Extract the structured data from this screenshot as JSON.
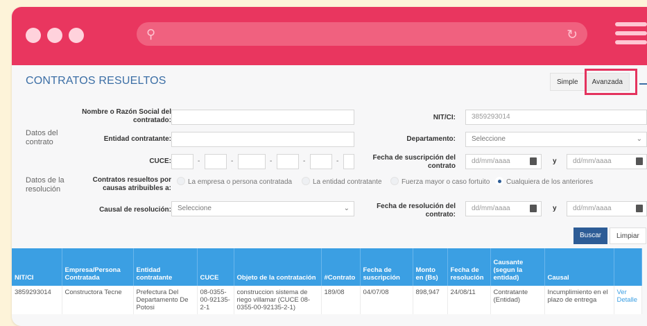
{
  "browser": {
    "search_icon": "search-icon",
    "reload_icon": "reload-icon",
    "menu_icon": "hamburger-menu-icon",
    "accent_color": "#e9365f"
  },
  "page": {
    "title": "CONTRATOS RESUELTOS",
    "tabs": [
      "Simple",
      "Avanzada"
    ],
    "active_tab": "Avanzada"
  },
  "form": {
    "section_contract": "Datos del contrato",
    "section_resolution": "Datos de la resolución",
    "razon_social_label": "Nombre o Razón Social del contratado:",
    "razon_social_value": "",
    "nit_label": "NIT/CI:",
    "nit_value": "3859293014",
    "entidad_label": "Entidad contratante:",
    "entidad_value": "",
    "departamento_label": "Departamento:",
    "departamento_value": "Seleccione",
    "cuce_label": "CUCE:",
    "cuce_separator": "-",
    "fecha_suscripcion_label": "Fecha de suscripción del contrato",
    "date_placeholder": "dd/mm/aaaa",
    "y_label": "y",
    "atribuibles_label": "Contratos resueltos por causas atribuibles a:",
    "radio_options": [
      "La empresa o persona contratada",
      "La entidad contratante",
      "Fuerza mayor o caso fortuito",
      "Cualquiera de los anteriores"
    ],
    "radio_selected": "Cualquiera de los anteriores",
    "causal_label": "Causal de resolución:",
    "causal_value": "Seleccione",
    "fecha_resolucion_label": "Fecha de resolución del contrato:",
    "buscar_label": "Buscar",
    "limpiar_label": "Limpiar",
    "primary_color": "#2d5c96"
  },
  "table": {
    "header_color": "#3b9fe3",
    "headers": [
      "NIT/CI",
      "Empresa/Persona Contratada",
      "Entidad contratante",
      "CUCE",
      "Objeto de la contratación",
      "#Contrato",
      "Fecha de suscripción",
      "Monto en (Bs)",
      "Fecha de resolución",
      "Causante (segun la entidad)",
      "Causal",
      ""
    ],
    "rows": [
      {
        "nit": "3859293014",
        "empresa": "Constructora Tecne",
        "entidad": "Prefectura Del Departamento De Potosi",
        "cuce": "08-0355-00-92135-2-1",
        "objeto": "construccion sistema de riego villamar (CUCE 08-0355-00-92135-2-1)",
        "contrato": "189/08",
        "fecha_suscripcion": "04/07/08",
        "monto": "898,947",
        "fecha_resolucion": "24/08/11",
        "causante": "Contratante (Entidad)",
        "causal": "Incumplimiento en el plazo de entrega",
        "action": "Ver Detalle"
      }
    ]
  }
}
